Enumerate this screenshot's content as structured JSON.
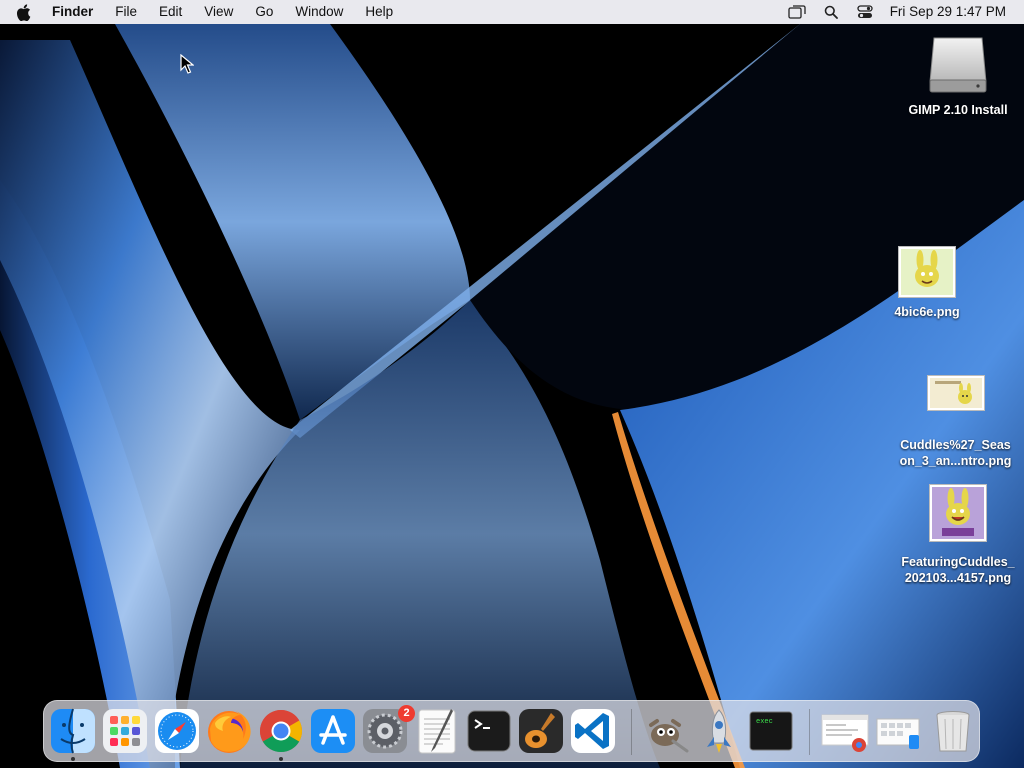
{
  "menubar": {
    "app_name": "Finder",
    "menus": [
      "File",
      "Edit",
      "View",
      "Go",
      "Window",
      "Help"
    ],
    "clock": "Fri Sep 29  1:47 PM",
    "status_icons": [
      "screen-mirroring-icon",
      "spotlight-search-icon",
      "control-center-icon"
    ]
  },
  "desktop": {
    "items": [
      {
        "label": "GIMP 2.10 Install",
        "icon": "drive-icon"
      },
      {
        "label": "4bic6e.png",
        "icon": "image-thumbnail-icon"
      },
      {
        "label_line1": "Cuddles%27_Seas",
        "label_line2": "on_3_an...ntro.png",
        "icon": "image-thumbnail-icon"
      },
      {
        "label_line1": "FeaturingCuddles_",
        "label_line2": "202103...4157.png",
        "icon": "image-thumbnail-icon"
      }
    ]
  },
  "dock": {
    "apps": [
      {
        "name": "Finder",
        "icon": "finder-icon",
        "running": true
      },
      {
        "name": "Launchpad",
        "icon": "launchpad-icon"
      },
      {
        "name": "Safari",
        "icon": "safari-icon"
      },
      {
        "name": "Firefox",
        "icon": "firefox-icon"
      },
      {
        "name": "Google Chrome",
        "icon": "chrome-icon",
        "running": true
      },
      {
        "name": "App Store",
        "icon": "app-store-icon"
      },
      {
        "name": "System Preferences",
        "icon": "system-preferences-icon",
        "badge": "2"
      },
      {
        "name": "TextEdit",
        "icon": "textedit-icon"
      },
      {
        "name": "Terminal",
        "icon": "terminal-icon"
      },
      {
        "name": "GarageBand",
        "icon": "garageband-icon"
      },
      {
        "name": "Visual Studio Code",
        "icon": "vscode-icon"
      },
      {
        "name": "GIMP",
        "icon": "gimp-icon"
      },
      {
        "name": "Python Launcher",
        "icon": "rocket-icon"
      },
      {
        "name": "exec",
        "icon": "exec-icon",
        "label": "exec"
      },
      {
        "name": "Chrome window",
        "icon": "chrome-window-icon"
      },
      {
        "name": "Downloads stack",
        "icon": "downloads-stack-icon"
      },
      {
        "name": "Trash",
        "icon": "trash-icon"
      }
    ]
  }
}
